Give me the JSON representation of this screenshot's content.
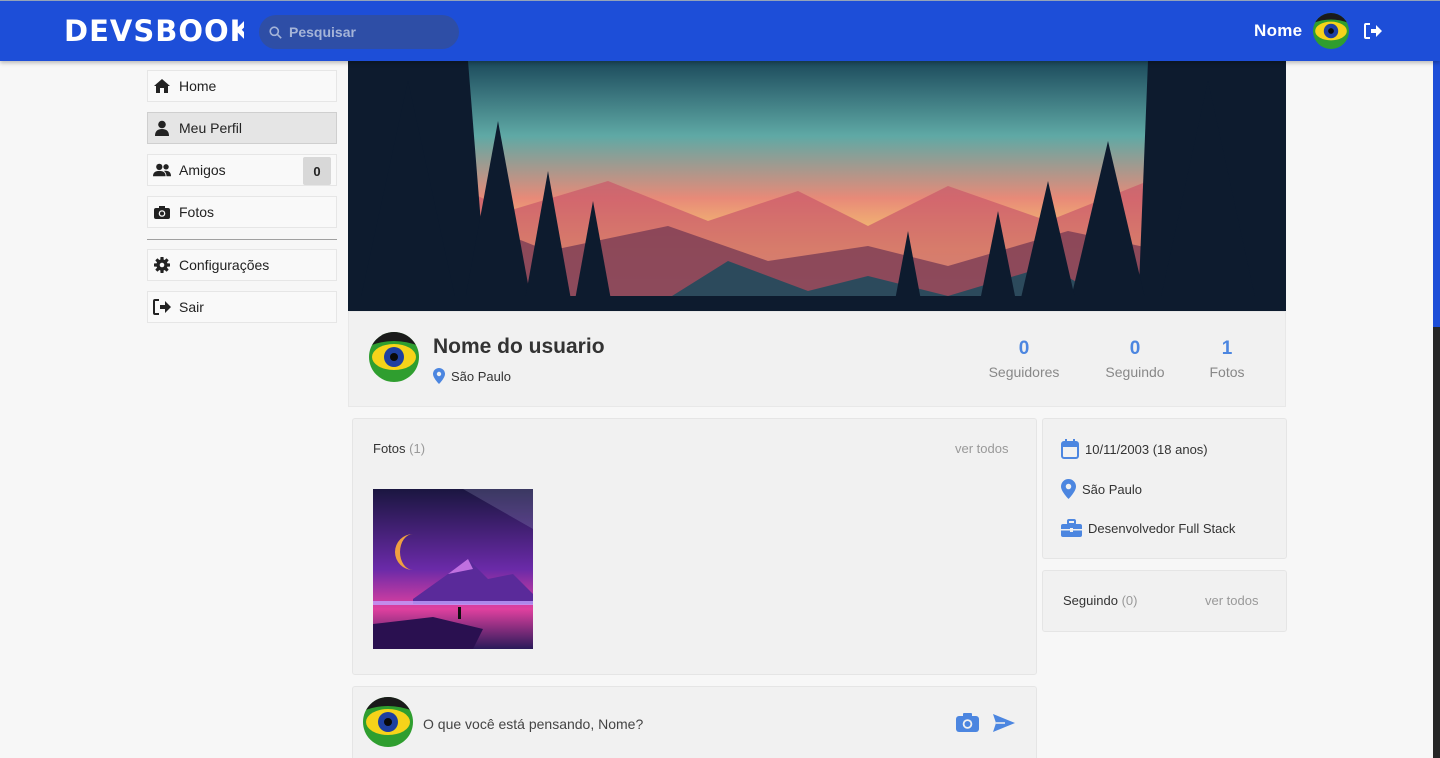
{
  "header": {
    "logo_text": "DEVSBOOK",
    "search_placeholder": "Pesquisar",
    "user_name": "Nome"
  },
  "sidebar": {
    "items": [
      {
        "label": "Home",
        "icon": "home-icon"
      },
      {
        "label": "Meu Perfil",
        "icon": "user-icon",
        "active": true
      },
      {
        "label": "Amigos",
        "icon": "users-icon",
        "badge": "0"
      },
      {
        "label": "Fotos",
        "icon": "camera-icon"
      },
      {
        "label": "Configurações",
        "icon": "gear-icon"
      },
      {
        "label": "Sair",
        "icon": "logout-icon"
      }
    ]
  },
  "profile": {
    "name": "Nome do usuario",
    "city": "São Paulo",
    "stats": [
      {
        "value": "0",
        "label": "Seguidores"
      },
      {
        "value": "0",
        "label": "Seguindo"
      },
      {
        "value": "1",
        "label": "Fotos"
      }
    ]
  },
  "photos_card": {
    "title": "Fotos",
    "count": "(1)",
    "see_all": "ver todos"
  },
  "info_card": {
    "birth": "10/11/2003 (18 anos)",
    "city": "São Paulo",
    "job": "Desenvolvedor Full Stack"
  },
  "following_card": {
    "title": "Seguindo",
    "count": "(0)",
    "see_all": "ver todos"
  },
  "post_box": {
    "placeholder": "O que você está pensando, Nome?"
  },
  "colors": {
    "header_bg": "#1d4ed8",
    "accent": "#4c86e0"
  }
}
